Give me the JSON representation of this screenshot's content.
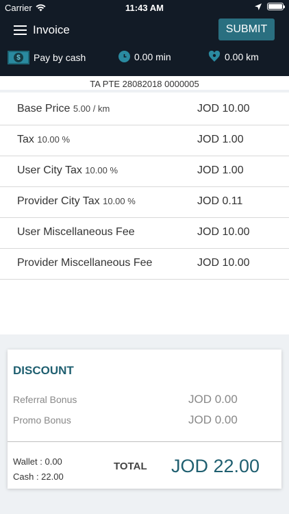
{
  "status_bar": {
    "carrier": "Carrier",
    "time": "11:43 AM"
  },
  "nav": {
    "title": "Invoice",
    "submit_label": "SUBMIT"
  },
  "trip_info": {
    "payment": "Pay by cash",
    "duration": "0.00 min",
    "distance": "0.00 km"
  },
  "booking_id": "TA PTE 28082018 0000005",
  "fare_items": [
    {
      "label": "Base Price",
      "rate": "5.00 / km",
      "value": "JOD 10.00"
    },
    {
      "label": "Tax",
      "rate": "10.00 %",
      "value": "JOD 1.00"
    },
    {
      "label": "User City Tax",
      "rate": "10.00 %",
      "value": "JOD 1.00"
    },
    {
      "label": "Provider City Tax",
      "rate": "10.00 %",
      "value": "JOD 0.11"
    },
    {
      "label": "User Miscellaneous Fee",
      "rate": "",
      "value": "JOD 10.00"
    },
    {
      "label": "Provider Miscellaneous Fee",
      "rate": "",
      "value": "JOD 10.00"
    }
  ],
  "discount": {
    "title": "DISCOUNT",
    "referral_label": "Referral Bonus",
    "referral_value": "JOD 0.00",
    "promo_label": "Promo Bonus",
    "promo_value": "JOD 0.00"
  },
  "summary": {
    "wallet": "Wallet : 0.00",
    "cash": "Cash : 22.00",
    "total_label": "TOTAL",
    "total_value": "JOD 22.00"
  },
  "colors": {
    "header_bg": "#121b26",
    "accent": "#2a6f80",
    "total_text": "#1f5f70"
  },
  "icons": [
    "menu-icon",
    "cash-icon",
    "clock-icon",
    "distance-icon",
    "wifi-icon",
    "location-arrow-icon",
    "battery-icon"
  ]
}
